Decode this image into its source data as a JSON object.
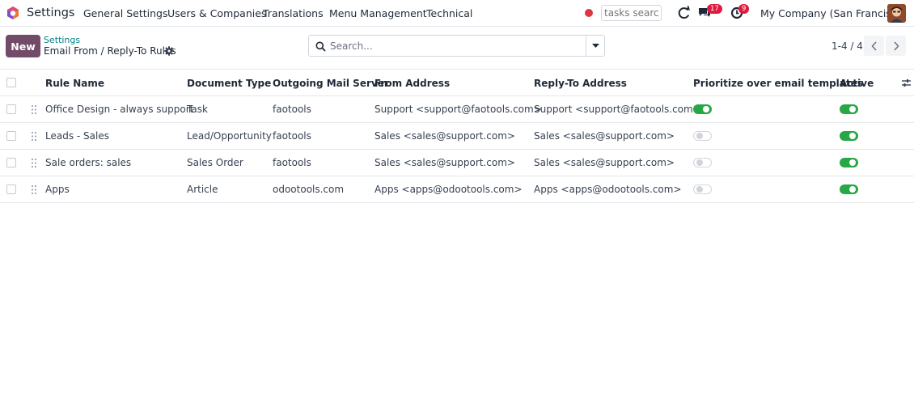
{
  "navbar": {
    "app_name": "Settings",
    "menu": [
      "General Settings",
      "Users & Companies",
      "Translations",
      "Menu Management",
      "Technical"
    ],
    "search_placeholder": "tasks search",
    "messages_count": "17",
    "activities_count": "9",
    "company": "My Company (San Francisco)"
  },
  "control_panel": {
    "new_label": "New",
    "breadcrumb_parent": "Settings",
    "breadcrumb_current": "Email From / Reply-To Rules",
    "search_placeholder": "Search...",
    "pager": "1-4 / 4"
  },
  "table": {
    "headers": [
      "Rule Name",
      "Document Type",
      "Outgoing Mail Server",
      "From Address",
      "Reply-To Address",
      "Prioritize over email templates",
      "Active"
    ],
    "rows": [
      {
        "name": "Office Design - always support",
        "doc_type": "Task",
        "server": "faotools",
        "from": "Support <support@faotools.com>",
        "reply_to": "Support <support@faotools.com>",
        "prioritize": true,
        "active": true
      },
      {
        "name": "Leads - Sales",
        "doc_type": "Lead/Opportunity",
        "server": "faotools",
        "from": "Sales <sales@support.com>",
        "reply_to": "Sales <sales@support.com>",
        "prioritize": false,
        "active": true
      },
      {
        "name": "Sale orders: sales",
        "doc_type": "Sales Order",
        "server": "faotools",
        "from": "Sales <sales@support.com>",
        "reply_to": "Sales <sales@support.com>",
        "prioritize": false,
        "active": true
      },
      {
        "name": "Apps",
        "doc_type": "Article",
        "server": "odootools.com",
        "from": "Apps <apps@odootools.com>",
        "reply_to": "Apps <apps@odootools.com>",
        "prioritize": false,
        "active": true
      }
    ]
  },
  "colors": {
    "primary": "#714b67",
    "link": "#017e84",
    "toggle_on": "#28a745",
    "badge": "#e0193f",
    "status_dot": "#dc3545"
  }
}
